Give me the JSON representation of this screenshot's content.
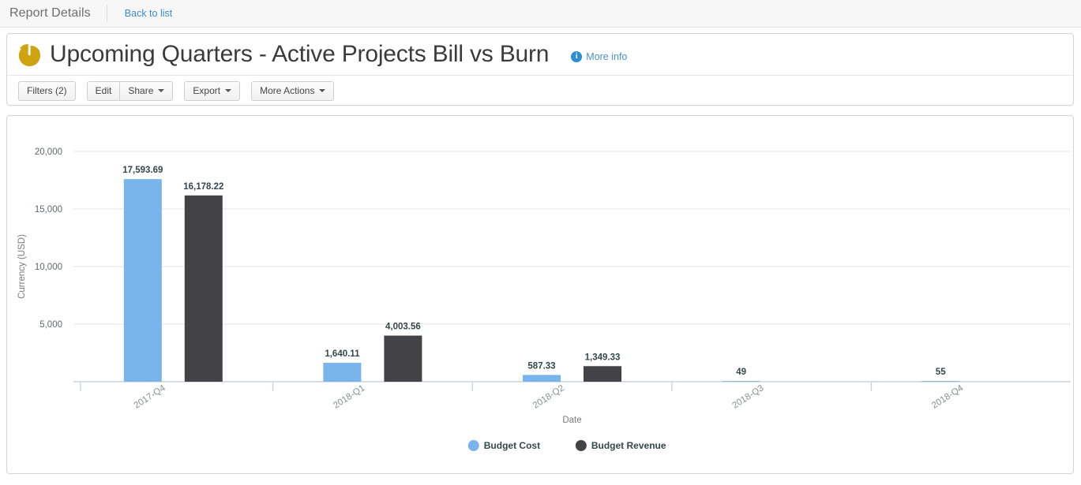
{
  "topbar": {
    "title": "Report Details",
    "back_link": "Back to list"
  },
  "header": {
    "title": "Upcoming Quarters - Active Projects Bill vs Burn",
    "icon": "pie-chart-icon",
    "more_info": {
      "label": "More info",
      "icon": "info-icon"
    }
  },
  "toolbar": {
    "filters_label": "Filters (2)",
    "edit_label": "Edit",
    "share_label": "Share",
    "export_label": "Export",
    "more_actions_label": "More Actions"
  },
  "colors": {
    "budget_cost": "#7ab4ec",
    "budget_revenue": "#434246",
    "value_label": "#34484b",
    "gridline": "#e4e4e4",
    "link": "#3a8ccc",
    "info_icon": "#2a8fd4",
    "pie_icon": "#cfa310"
  },
  "chart_data": {
    "type": "bar",
    "title": "Upcoming Quarters - Active Projects Bill vs Burn",
    "xlabel": "Date",
    "ylabel": "Currency (USD)",
    "categories": [
      "2017-Q4",
      "2018-Q1",
      "2018-Q2",
      "2018-Q3",
      "2018-Q4"
    ],
    "series": [
      {
        "name": "Budget Cost",
        "color": "#7ab4ec",
        "values": [
          17593.69,
          1640.11,
          587.33,
          49,
          55
        ],
        "labels": [
          "17,593.69",
          "1,640.11",
          "587.33",
          "49",
          "55"
        ]
      },
      {
        "name": "Budget Revenue",
        "color": "#434246",
        "values": [
          16178.22,
          4003.56,
          1349.33,
          null,
          null
        ],
        "labels": [
          "16,178.22",
          "4,003.56",
          "1,349.33",
          "",
          ""
        ]
      }
    ],
    "yticks": [
      5000,
      10000,
      15000,
      20000
    ],
    "ytick_labels": [
      "5,000",
      "10,000",
      "15,000",
      "20,000"
    ],
    "ylim": [
      0,
      20000
    ],
    "grid": true,
    "legend_position": "bottom",
    "legend": [
      {
        "name": "Budget Cost",
        "color": "#7ab4ec"
      },
      {
        "name": "Budget Revenue",
        "color": "#434246"
      }
    ]
  }
}
